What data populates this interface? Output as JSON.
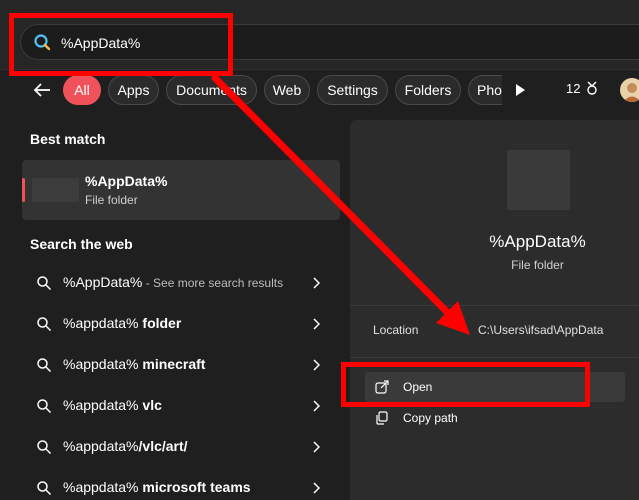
{
  "search": {
    "query": "%AppData%"
  },
  "filters": {
    "chips": [
      "All",
      "Apps",
      "Documents",
      "Web",
      "Settings",
      "Folders",
      "Pho"
    ],
    "points": "12"
  },
  "left": {
    "best_match_title": "Best match",
    "best_match": {
      "name": "%AppData%",
      "type": "File folder"
    },
    "web_title": "Search the web",
    "web_results": [
      {
        "text": "%AppData%",
        "sub": " - See more search results"
      },
      {
        "prefix": "%appdata% ",
        "bold": "folder"
      },
      {
        "prefix": "%appdata% ",
        "bold": "minecraft"
      },
      {
        "prefix": "%appdata% ",
        "bold": "vlc"
      },
      {
        "prefix": "%appdata%",
        "bold": "/vlc/art/"
      },
      {
        "prefix": "%appdata% ",
        "bold": "microsoft teams"
      }
    ]
  },
  "preview": {
    "title": "%AppData%",
    "subtitle": "File folder",
    "location_label": "Location",
    "location_value": "C:\\Users\\ifsad\\AppData",
    "actions": {
      "open": "Open",
      "copy_path": "Copy path"
    }
  },
  "colors": {
    "accent": "#f0525c",
    "annotation": "#ff0000"
  }
}
